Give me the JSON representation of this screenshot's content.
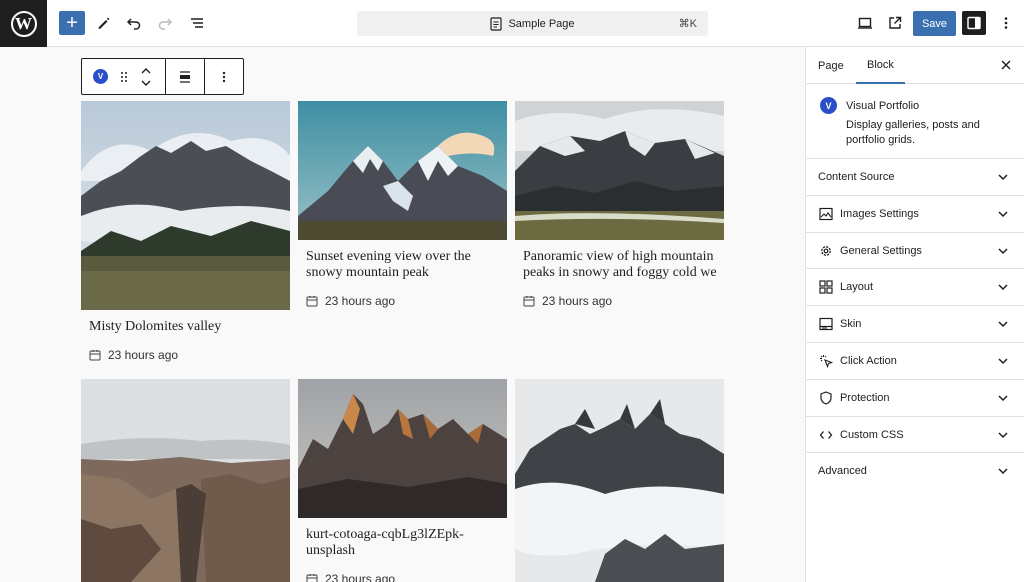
{
  "header": {
    "add_label": "+",
    "document_title": "Sample Page",
    "shortcut": "⌘K",
    "save_label": "Save"
  },
  "block_toolbar": {
    "block_badge": "V"
  },
  "cards": [
    {
      "title": "Misty Dolomites valley",
      "date": "23 hours ago"
    },
    {
      "title": "Sunset evening view over the\nsnowy mountain peak",
      "date": "23 hours ago"
    },
    {
      "title": "Panoramic view of high mountain\npeaks in snowy and foggy cold we",
      "date": "23 hours ago"
    },
    {
      "title": "",
      "date": ""
    },
    {
      "title": "kurt-cotoaga-cqbLg3lZEpk-\nunsplash",
      "date": "23 hours ago"
    },
    {
      "title": "",
      "date": ""
    }
  ],
  "sidebar": {
    "tabs": [
      "Page",
      "Block"
    ],
    "active_tab": "Block",
    "block": {
      "badge": "V",
      "name": "Visual Portfolio",
      "description": "Display galleries, posts and portfolio grids."
    },
    "panels": [
      {
        "label": "Content Source",
        "icon": "none"
      },
      {
        "label": "Images Settings",
        "icon": "image-icon"
      },
      {
        "label": "General Settings",
        "icon": "gear-icon"
      },
      {
        "label": "Layout",
        "icon": "grid-icon"
      },
      {
        "label": "Skin",
        "icon": "skin-icon"
      },
      {
        "label": "Click Action",
        "icon": "cursor-click-icon"
      },
      {
        "label": "Protection",
        "icon": "shield-icon"
      },
      {
        "label": "Custom CSS",
        "icon": "code-icon"
      },
      {
        "label": "Advanced",
        "icon": "none"
      }
    ]
  },
  "colors": {
    "accent": "#3a6fb0",
    "badge": "#2a4fc8",
    "logo_bg": "#1e1e1e"
  }
}
